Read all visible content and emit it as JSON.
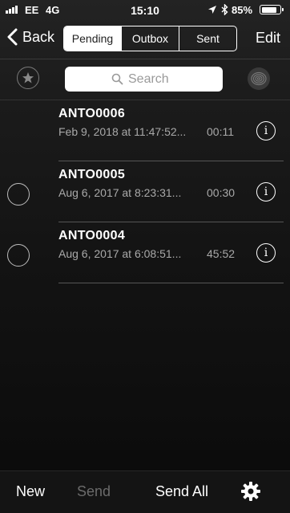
{
  "status_bar": {
    "carrier": "EE",
    "network": "4G",
    "time": "15:10",
    "battery_percent": "85%",
    "battery_level": 0.85,
    "icons": [
      "signal-icon",
      "location-arrow-icon",
      "bluetooth-icon",
      "battery-icon"
    ]
  },
  "nav": {
    "back_label": "Back",
    "segments": [
      "Pending",
      "Outbox",
      "Sent"
    ],
    "selected_segment": "Pending",
    "edit_label": "Edit"
  },
  "search": {
    "placeholder": "Search",
    "icons": [
      "star-icon",
      "search-icon",
      "fingerprint-icon"
    ]
  },
  "recordings": [
    {
      "name": "ANTO0006",
      "date": "Feb 9, 2018 at 11:47:52...",
      "duration": "00:11",
      "has_select_circle": false
    },
    {
      "name": "ANTO0005",
      "date": "Aug 6, 2017 at 8:23:31...",
      "duration": "00:30",
      "has_select_circle": true
    },
    {
      "name": "ANTO0004",
      "date": "Aug 6, 2017 at 6:08:51...",
      "duration": "45:52",
      "has_select_circle": true
    }
  ],
  "toolbar": {
    "new_label": "New",
    "send_label": "Send",
    "send_all_label": "Send All",
    "settings_icon": "gear-icon"
  },
  "colors": {
    "background": "#1b1b1b",
    "text_primary": "#ffffff",
    "text_secondary": "#a9a9a9",
    "disabled": "#6b6b6b"
  }
}
